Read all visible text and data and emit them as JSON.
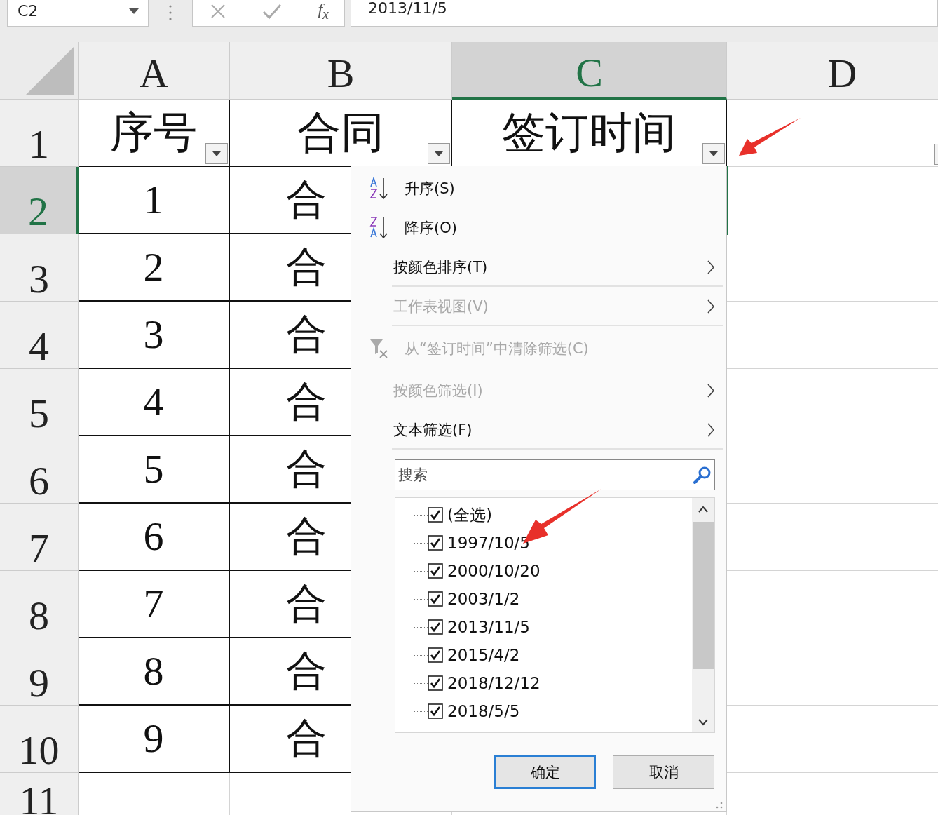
{
  "formula_bar": {
    "name_box": "C2",
    "function_label": "f$_{x}$",
    "formula": "2013/11/5"
  },
  "sheet": {
    "columns": [
      {
        "label": "A",
        "selected": false
      },
      {
        "label": "B",
        "selected": false
      },
      {
        "label": "C",
        "selected": true
      },
      {
        "label": "D",
        "selected": false
      }
    ],
    "rows": [
      {
        "label": "1",
        "selected": false,
        "kind": "header",
        "cells": [
          "序号",
          "合同",
          "签订时间"
        ]
      },
      {
        "label": "2",
        "selected": true,
        "kind": "data",
        "cells": [
          "1",
          "合"
        ]
      },
      {
        "label": "3",
        "selected": false,
        "kind": "data",
        "cells": [
          "2",
          "合"
        ]
      },
      {
        "label": "4",
        "selected": false,
        "kind": "data",
        "cells": [
          "3",
          "合"
        ]
      },
      {
        "label": "5",
        "selected": false,
        "kind": "data",
        "cells": [
          "4",
          "合"
        ]
      },
      {
        "label": "6",
        "selected": false,
        "kind": "data",
        "cells": [
          "5",
          "合"
        ]
      },
      {
        "label": "7",
        "selected": false,
        "kind": "data",
        "cells": [
          "6",
          "合"
        ]
      },
      {
        "label": "8",
        "selected": false,
        "kind": "data",
        "cells": [
          "7",
          "合"
        ]
      },
      {
        "label": "9",
        "selected": false,
        "kind": "data",
        "cells": [
          "8",
          "合"
        ]
      },
      {
        "label": "10",
        "selected": false,
        "kind": "data",
        "cells": [
          "9",
          "合"
        ]
      },
      {
        "label": "11",
        "selected": false,
        "kind": "blank"
      }
    ]
  },
  "filter_menu": {
    "items": [
      {
        "kind": "sort_asc",
        "label": "升序(S)",
        "disabled": false,
        "submenu": false,
        "separator_after": false
      },
      {
        "kind": "sort_desc",
        "label": "降序(O)",
        "disabled": false,
        "submenu": false,
        "separator_after": false
      },
      {
        "kind": "plain",
        "label": "按颜色排序(T)",
        "disabled": false,
        "submenu": true,
        "separator_after": true
      },
      {
        "kind": "plain",
        "label": "工作表视图(V)",
        "disabled": true,
        "submenu": true,
        "separator_after": true
      },
      {
        "kind": "clear",
        "label": "从“签订时间”中清除筛选(C)",
        "disabled": true,
        "submenu": false,
        "separator_after": false
      },
      {
        "kind": "plain",
        "label": "按颜色筛选(I)",
        "disabled": true,
        "submenu": true,
        "separator_after": false
      },
      {
        "kind": "plain",
        "label": "文本筛选(F)",
        "disabled": false,
        "submenu": true,
        "separator_after": true
      }
    ],
    "search": {
      "placeholder": "搜索"
    },
    "values": [
      {
        "label": "(全选)",
        "checked": true
      },
      {
        "label": "1997/10/5",
        "checked": true
      },
      {
        "label": "2000/10/20",
        "checked": true
      },
      {
        "label": "2003/1/2",
        "checked": true
      },
      {
        "label": "2013/11/5",
        "checked": true
      },
      {
        "label": "2015/4/2",
        "checked": true
      },
      {
        "label": "2018/12/12",
        "checked": true
      },
      {
        "label": "2018/5/5",
        "checked": true
      }
    ],
    "buttons": [
      {
        "label": "确定",
        "default": true
      },
      {
        "label": "取消",
        "default": false
      }
    ]
  }
}
